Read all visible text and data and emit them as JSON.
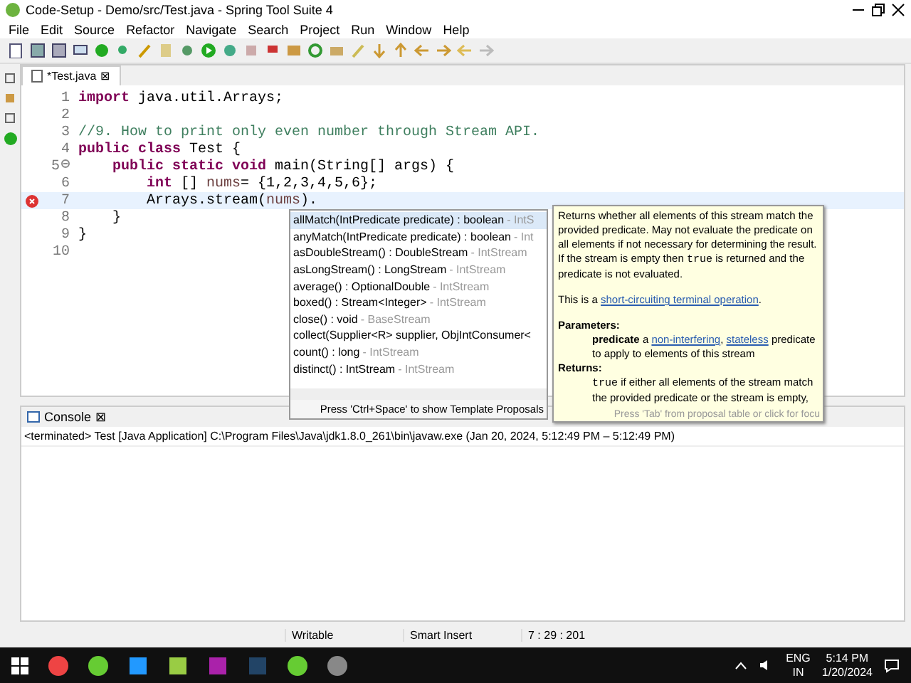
{
  "window": {
    "title": "Code-Setup - Demo/src/Test.java - Spring Tool Suite 4"
  },
  "menu": [
    "File",
    "Edit",
    "Source",
    "Refactor",
    "Navigate",
    "Search",
    "Project",
    "Run",
    "Window",
    "Help"
  ],
  "editor_tab": {
    "label": "*Test.java",
    "close": "⊠",
    "selected": true
  },
  "code_lines": [
    {
      "number": "1",
      "fold": false,
      "error": false,
      "current": false,
      "tokens": [
        {
          "kind": "keyword",
          "text": "import"
        },
        {
          "kind": "plain",
          "text": " java.util.Arrays;"
        }
      ]
    },
    {
      "number": "2",
      "fold": false,
      "error": false,
      "current": false
    },
    {
      "number": "3",
      "fold": false,
      "error": false,
      "current": false,
      "tokens": [
        {
          "kind": "comment",
          "text": "//9. How to print only even number through Stream API."
        }
      ]
    },
    {
      "number": "4",
      "fold": false,
      "error": false,
      "current": false,
      "tokens": [
        {
          "kind": "keyword",
          "text": "public class"
        },
        {
          "kind": "plain",
          "text": " Test {"
        }
      ]
    },
    {
      "number": "5",
      "fold": true,
      "error": false,
      "current": false,
      "tokens": [
        {
          "kind": "keyword",
          "text": "    public static void"
        },
        {
          "kind": "plain",
          "text": " main(String[] args) {"
        }
      ]
    },
    {
      "number": "6",
      "fold": false,
      "error": false,
      "current": false,
      "tokens": [
        {
          "kind": "keyword",
          "text": "        int"
        },
        {
          "kind": "plain",
          "text": " [] "
        },
        {
          "kind": "variable",
          "text": "nums"
        },
        {
          "kind": "plain",
          "text": "= {1,2,3,4,5,6};"
        }
      ]
    },
    {
      "number": "7",
      "fold": false,
      "error": true,
      "current": true,
      "tokens": [
        {
          "kind": "plain",
          "text": "        Arrays.stream("
        },
        {
          "kind": "variable",
          "text": "nums"
        },
        {
          "kind": "plain",
          "text": ")."
        }
      ]
    },
    {
      "number": "8",
      "fold": false,
      "error": false,
      "current": false,
      "tokens": [
        {
          "kind": "plain",
          "text": "    }"
        }
      ]
    },
    {
      "number": "9",
      "fold": false,
      "error": false,
      "current": false,
      "tokens": [
        {
          "kind": "plain",
          "text": "}"
        }
      ]
    },
    {
      "number": "10",
      "fold": false,
      "error": false,
      "current": false
    }
  ],
  "proposals": {
    "items": [
      {
        "signature": "allMatch(IntPredicate predicate) : boolean",
        "owner": "- IntS",
        "selected": true
      },
      {
        "signature": "anyMatch(IntPredicate predicate) : boolean",
        "owner": "- Int",
        "selected": false
      },
      {
        "signature": "asDoubleStream() : DoubleStream",
        "owner": "- IntStream",
        "selected": false
      },
      {
        "signature": "asLongStream() : LongStream",
        "owner": "- IntStream",
        "selected": false
      },
      {
        "signature": "average() : OptionalDouble",
        "owner": "- IntStream",
        "selected": false
      },
      {
        "signature": "boxed() : Stream<Integer>",
        "owner": "- IntStream",
        "selected": false
      },
      {
        "signature": "close() : void",
        "owner": "- BaseStream",
        "selected": false
      },
      {
        "signature": "collect(Supplier<R> supplier, ObjIntConsumer<",
        "selected": false
      },
      {
        "signature": "count() : long",
        "owner": "- IntStream",
        "selected": false
      },
      {
        "signature": "distinct() : IntStream",
        "owner": "- IntStream",
        "selected": false
      }
    ],
    "footer": "Press 'Ctrl+Space' to show Template Proposals"
  },
  "doc": {
    "blocks": [
      {
        "kind": "para",
        "parts": [
          {
            "kind": "text",
            "text": "Returns whether all elements of this stream match the provided predicate. May not evaluate the predicate on all elements if not necessary for determining the result. If the stream is empty then "
          },
          {
            "kind": "code",
            "text": "true"
          },
          {
            "kind": "text",
            "text": " is returned and the predicate is not evaluated."
          }
        ]
      },
      {
        "kind": "para",
        "parts": [
          {
            "kind": "text",
            "text": "This is a "
          },
          {
            "kind": "link",
            "text": "short-circuiting terminal operation"
          },
          {
            "kind": "text",
            "text": "."
          }
        ]
      },
      {
        "kind": "heading",
        "parts": [
          {
            "kind": "text",
            "text": "Parameters:"
          }
        ]
      },
      {
        "kind": "indent",
        "parts": [
          {
            "kind": "bold",
            "text": "predicate"
          },
          {
            "kind": "text",
            "text": " a "
          },
          {
            "kind": "link",
            "text": "non-interfering"
          },
          {
            "kind": "text",
            "text": ", "
          },
          {
            "kind": "link",
            "text": "stateless"
          },
          {
            "kind": "text",
            "text": " predicate to apply to elements of this stream"
          }
        ]
      },
      {
        "kind": "heading",
        "parts": [
          {
            "kind": "text",
            "text": "Returns:"
          }
        ]
      },
      {
        "kind": "indent",
        "parts": [
          {
            "kind": "code",
            "text": "true"
          },
          {
            "kind": "text",
            "text": " if either all elements of the stream match the provided predicate or the stream is empty,"
          }
        ]
      }
    ],
    "footer": "Press 'Tab' from proposal table or click for focu"
  },
  "console": {
    "label": "Console",
    "close": "⊠",
    "status": "<terminated> Test [Java Application] C:\\Program Files\\Java\\jdk1.8.0_261\\bin\\javaw.exe  (Jan 20, 2024, 5:12:49 PM – 5:12:49 PM)"
  },
  "status_bar": [
    "Writable",
    "Smart Insert",
    "7 : 29 : 201"
  ],
  "taskbar": {
    "language": "ENG",
    "region": "IN",
    "time": "5:14 PM",
    "date": "1/20/2024"
  }
}
